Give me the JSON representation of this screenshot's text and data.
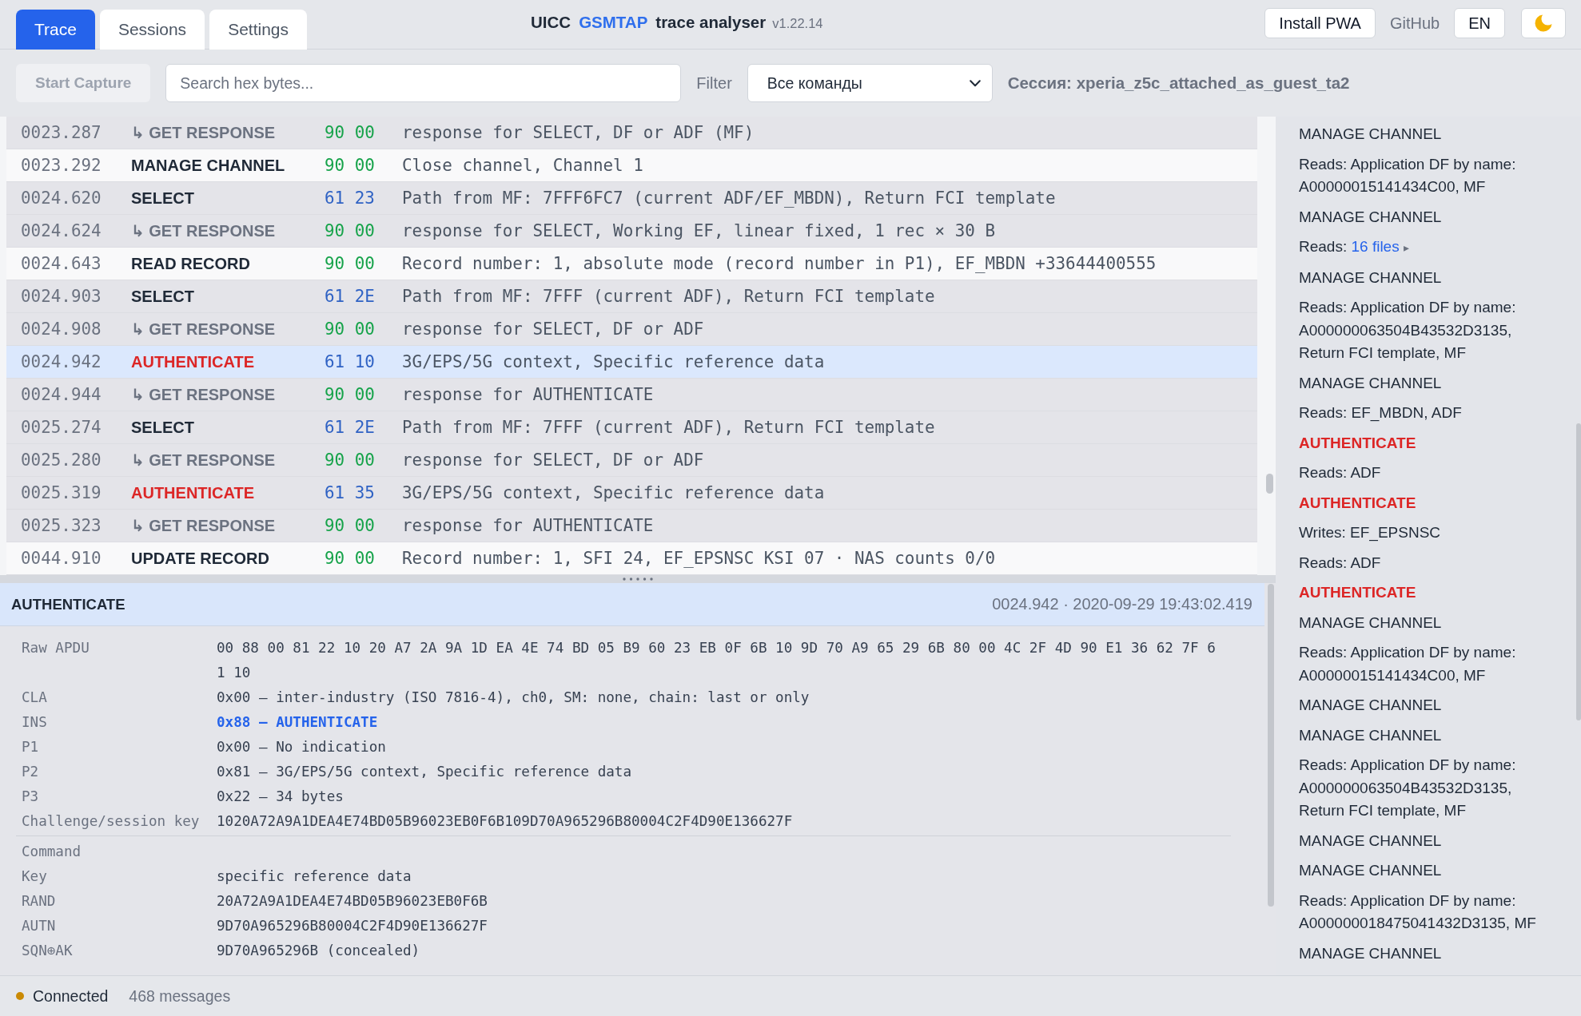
{
  "tabs": [
    {
      "label": "Trace",
      "selected": true
    },
    {
      "label": "Sessions",
      "selected": false
    },
    {
      "label": "Settings",
      "selected": false
    }
  ],
  "app_title": {
    "prefix": "UICC",
    "highlight": "GSMTAP",
    "name": "trace analyser",
    "version": "v1.22.14"
  },
  "header_actions": {
    "install_button": "Install PWA",
    "github_link": "GitHub",
    "language_button": "EN"
  },
  "toolbar": {
    "capture_button": {
      "label": "Start Capture",
      "disabled": true
    },
    "search": {
      "placeholder": "Search hex bytes..."
    },
    "filter": {
      "label": "Filter",
      "value": "Все команды"
    },
    "session": "Сессия: xperia_z5c_attached_as_guest_ta2"
  },
  "table": {
    "rows": [
      {
        "time": "0023.287",
        "command": "↳ GET RESPONSE",
        "kind": "response",
        "sw": {
          "text": "90 00",
          "kind": "ok"
        },
        "description": "response for SELECT, DF or ADF (MF)",
        "grouped": true,
        "selected": false
      },
      {
        "time": "0023.292",
        "command": "MANAGE CHANNEL",
        "kind": "command",
        "sw": {
          "text": "90 00",
          "kind": "ok"
        },
        "description": "Close channel, Channel 1",
        "grouped": false,
        "selected": false
      },
      {
        "time": "0024.620",
        "command": "SELECT",
        "kind": "command",
        "sw": {
          "text": "61 23",
          "kind": "more"
        },
        "description": "Path from MF: 7FFF6FC7 (current ADF/EF_MBDN), Return FCI template",
        "grouped": true,
        "selected": false
      },
      {
        "time": "0024.624",
        "command": "↳ GET RESPONSE",
        "kind": "response",
        "sw": {
          "text": "90 00",
          "kind": "ok"
        },
        "description": "response for SELECT, Working EF, linear fixed, 1 rec × 30 B",
        "grouped": true,
        "selected": false
      },
      {
        "time": "0024.643",
        "command": "READ RECORD",
        "kind": "command",
        "sw": {
          "text": "90 00",
          "kind": "ok"
        },
        "description": "Record number: 1, absolute mode (record number in P1), EF_MBDN +33644400555",
        "grouped": false,
        "selected": false
      },
      {
        "time": "0024.903",
        "command": "SELECT",
        "kind": "command",
        "sw": {
          "text": "61 2E",
          "kind": "more"
        },
        "description": "Path from MF: 7FFF (current ADF), Return FCI template",
        "grouped": true,
        "selected": false
      },
      {
        "time": "0024.908",
        "command": "↳ GET RESPONSE",
        "kind": "response",
        "sw": {
          "text": "90 00",
          "kind": "ok"
        },
        "description": "response for SELECT, DF or ADF",
        "grouped": true,
        "selected": false
      },
      {
        "time": "0024.942",
        "command": "AUTHENTICATE",
        "kind": "auth",
        "sw": {
          "text": "61 10",
          "kind": "more"
        },
        "description": "3G/EPS/5G context, Specific reference data",
        "grouped": true,
        "selected": true
      },
      {
        "time": "0024.944",
        "command": "↳ GET RESPONSE",
        "kind": "response",
        "sw": {
          "text": "90 00",
          "kind": "ok"
        },
        "description": "response for AUTHENTICATE",
        "grouped": true,
        "selected": false
      },
      {
        "time": "0025.274",
        "command": "SELECT",
        "kind": "command",
        "sw": {
          "text": "61 2E",
          "kind": "more"
        },
        "description": "Path from MF: 7FFF (current ADF), Return FCI template",
        "grouped": true,
        "selected": false
      },
      {
        "time": "0025.280",
        "command": "↳ GET RESPONSE",
        "kind": "response",
        "sw": {
          "text": "90 00",
          "kind": "ok"
        },
        "description": "response for SELECT, DF or ADF",
        "grouped": true,
        "selected": false
      },
      {
        "time": "0025.319",
        "command": "AUTHENTICATE",
        "kind": "auth",
        "sw": {
          "text": "61 35",
          "kind": "more"
        },
        "description": "3G/EPS/5G context, Specific reference data",
        "grouped": true,
        "selected": false
      },
      {
        "time": "0025.323",
        "command": "↳ GET RESPONSE",
        "kind": "response",
        "sw": {
          "text": "90 00",
          "kind": "ok"
        },
        "description": "response for AUTHENTICATE",
        "grouped": true,
        "selected": false
      },
      {
        "time": "0044.910",
        "command": "UPDATE RECORD",
        "kind": "command",
        "sw": {
          "text": "90 00",
          "kind": "ok"
        },
        "description": "Record number: 1, SFI 24, EF_EPSNSC KSI 07 · NAS counts 0/0",
        "grouped": false,
        "selected": false
      }
    ]
  },
  "detail": {
    "title": "AUTHENTICATE",
    "meta": "0024.942 · 2020-09-29 19:43:02.419",
    "fields": [
      {
        "label": "Raw APDU",
        "value": "00 88 00 81 22 10 20 A7 2A 9A 1D EA 4E 74 BD 05 B9 60 23 EB 0F 6B 10 9D 70 A9 65 29 6B 80 00 4C 2F 4D 90 E1 36 62 7F 61 10",
        "highlighted": false
      },
      {
        "label": "CLA",
        "value": "0x00 — inter-industry (ISO 7816-4), ch0, SM: none, chain: last or only",
        "highlighted": false
      },
      {
        "label": "INS",
        "value": "0x88 — AUTHENTICATE",
        "highlighted": true
      },
      {
        "label": "P1",
        "value": "0x00 — No indication",
        "highlighted": false
      },
      {
        "label": "P2",
        "value": "0x81 — 3G/EPS/5G context, Specific reference data",
        "highlighted": false
      },
      {
        "label": "P3",
        "value": "0x22 — 34 bytes",
        "highlighted": false
      },
      {
        "label": "Challenge/session key",
        "value": "1020A72A9A1DEA4E74BD05B96023EB0F6B109D70A965296B80004C2F4D90E136627F",
        "highlighted": false
      }
    ],
    "sections": [
      {
        "title": "Command",
        "fields": [
          {
            "label": "Key",
            "value": "specific reference data",
            "highlighted": false
          },
          {
            "label": "RAND",
            "value": "20A72A9A1DEA4E74BD05B96023EB0F6B",
            "highlighted": false
          },
          {
            "label": "AUTN",
            "value": "9D70A965296B80004C2F4D90E136627F",
            "highlighted": false
          },
          {
            "label": "SQN⊕AK",
            "value": "9D70A965296B (concealed)",
            "highlighted": false
          }
        ]
      }
    ]
  },
  "sidebar": {
    "entries": [
      {
        "command": "MANAGE CHANNEL",
        "kind": "normal",
        "details": [
          {
            "text": "Reads: Application DF by name: A00000015141434C00, MF"
          }
        ]
      },
      {
        "command": "MANAGE CHANNEL",
        "kind": "normal",
        "details": [
          {
            "text": "Reads:",
            "link": "16 files",
            "toggle": "▸"
          }
        ]
      },
      {
        "command": "MANAGE CHANNEL",
        "kind": "normal",
        "details": [
          {
            "text": "Reads: Application DF by name: A000000063504B43532D3135, Return FCI template, MF"
          }
        ]
      },
      {
        "command": "MANAGE CHANNEL",
        "kind": "normal",
        "details": [
          {
            "text": "Reads: EF_MBDN, ADF"
          }
        ]
      },
      {
        "command": "AUTHENTICATE",
        "kind": "alert",
        "details": [
          {
            "text": "Reads: ADF"
          }
        ]
      },
      {
        "command": "AUTHENTICATE",
        "kind": "alert",
        "details": [
          {
            "text": "Writes: EF_EPSNSC"
          },
          {
            "text": "Reads: ADF"
          }
        ]
      },
      {
        "command": "AUTHENTICATE",
        "kind": "alert"
      },
      {
        "command": "MANAGE CHANNEL",
        "kind": "normal",
        "details": [
          {
            "text": "Reads: Application DF by name: A00000015141434C00, MF"
          }
        ]
      },
      {
        "command": "MANAGE CHANNEL",
        "kind": "normal"
      },
      {
        "command": "MANAGE CHANNEL",
        "kind": "normal",
        "details": [
          {
            "text": "Reads: Application DF by name: A000000063504B43532D3135, Return FCI template, MF"
          }
        ]
      },
      {
        "command": "MANAGE CHANNEL",
        "kind": "normal"
      },
      {
        "command": "MANAGE CHANNEL",
        "kind": "normal",
        "details": [
          {
            "text": "Reads: Application DF by name: A000000018475041432D3135, MF"
          }
        ]
      },
      {
        "command": "MANAGE CHANNEL",
        "kind": "normal"
      }
    ]
  },
  "status_bar": {
    "connected": true,
    "label": "Connected",
    "count": "468 messages"
  }
}
